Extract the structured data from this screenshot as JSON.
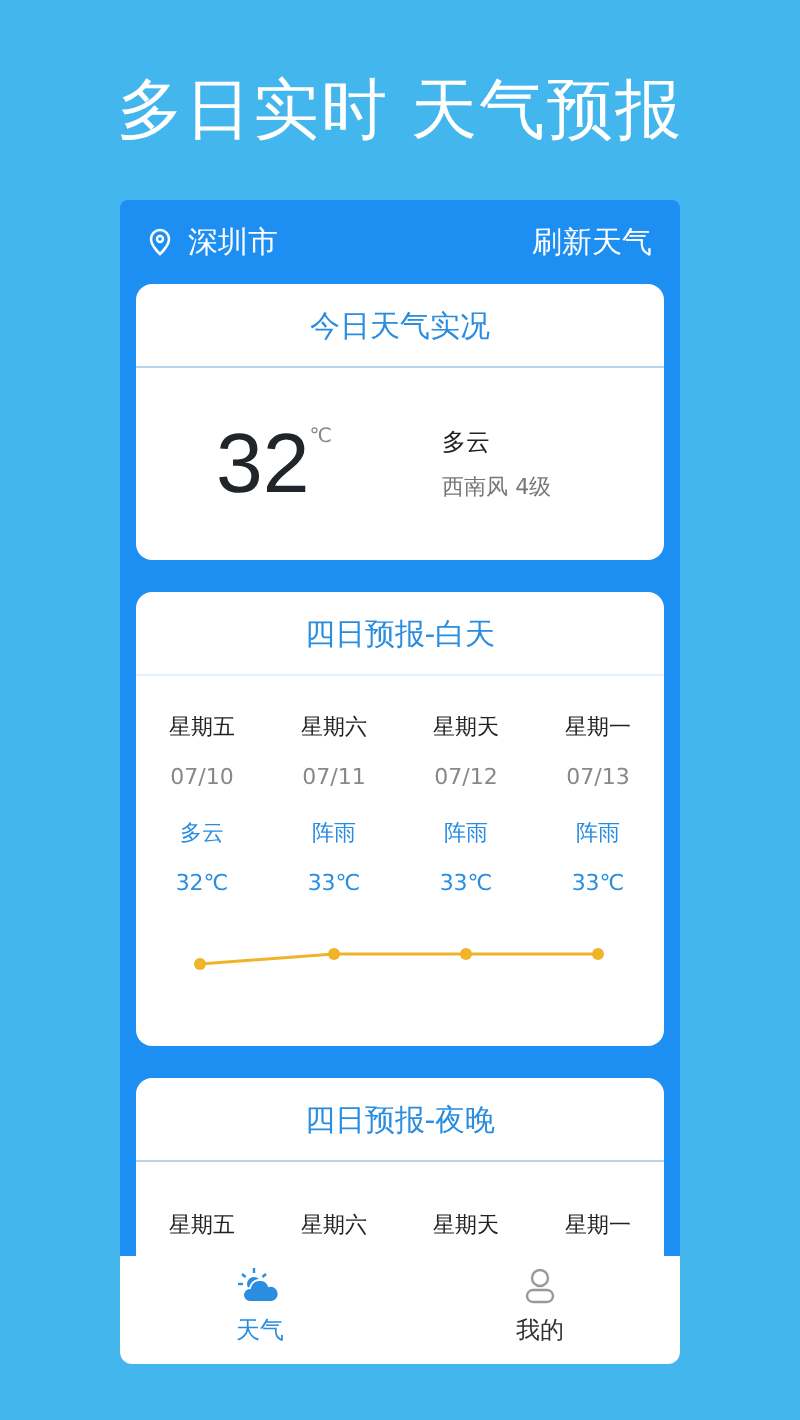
{
  "banner": {
    "title": "多日实时 天气预报"
  },
  "top_bar": {
    "city": "深圳市",
    "refresh": "刷新天气"
  },
  "today": {
    "title": "今日天气实况",
    "temperature": "32",
    "unit": "℃",
    "condition": "多云",
    "wind": "西南风 4级"
  },
  "day_forecast": {
    "title": "四日预报-白天",
    "days": [
      {
        "weekday": "星期五",
        "date": "07/10",
        "condition": "多云",
        "temp": "32℃"
      },
      {
        "weekday": "星期六",
        "date": "07/11",
        "condition": "阵雨",
        "temp": "33℃"
      },
      {
        "weekday": "星期天",
        "date": "07/12",
        "condition": "阵雨",
        "temp": "33℃"
      },
      {
        "weekday": "星期一",
        "date": "07/13",
        "condition": "阵雨",
        "temp": "33℃"
      }
    ]
  },
  "night_forecast": {
    "title": "四日预报-夜晚",
    "days": [
      {
        "weekday": "星期五"
      },
      {
        "weekday": "星期六"
      },
      {
        "weekday": "星期天"
      },
      {
        "weekday": "星期一"
      }
    ]
  },
  "tab_bar": [
    {
      "kind": "weather",
      "label": "天气",
      "selected": true
    },
    {
      "kind": "profile",
      "label": "我的",
      "selected": false
    }
  ]
}
